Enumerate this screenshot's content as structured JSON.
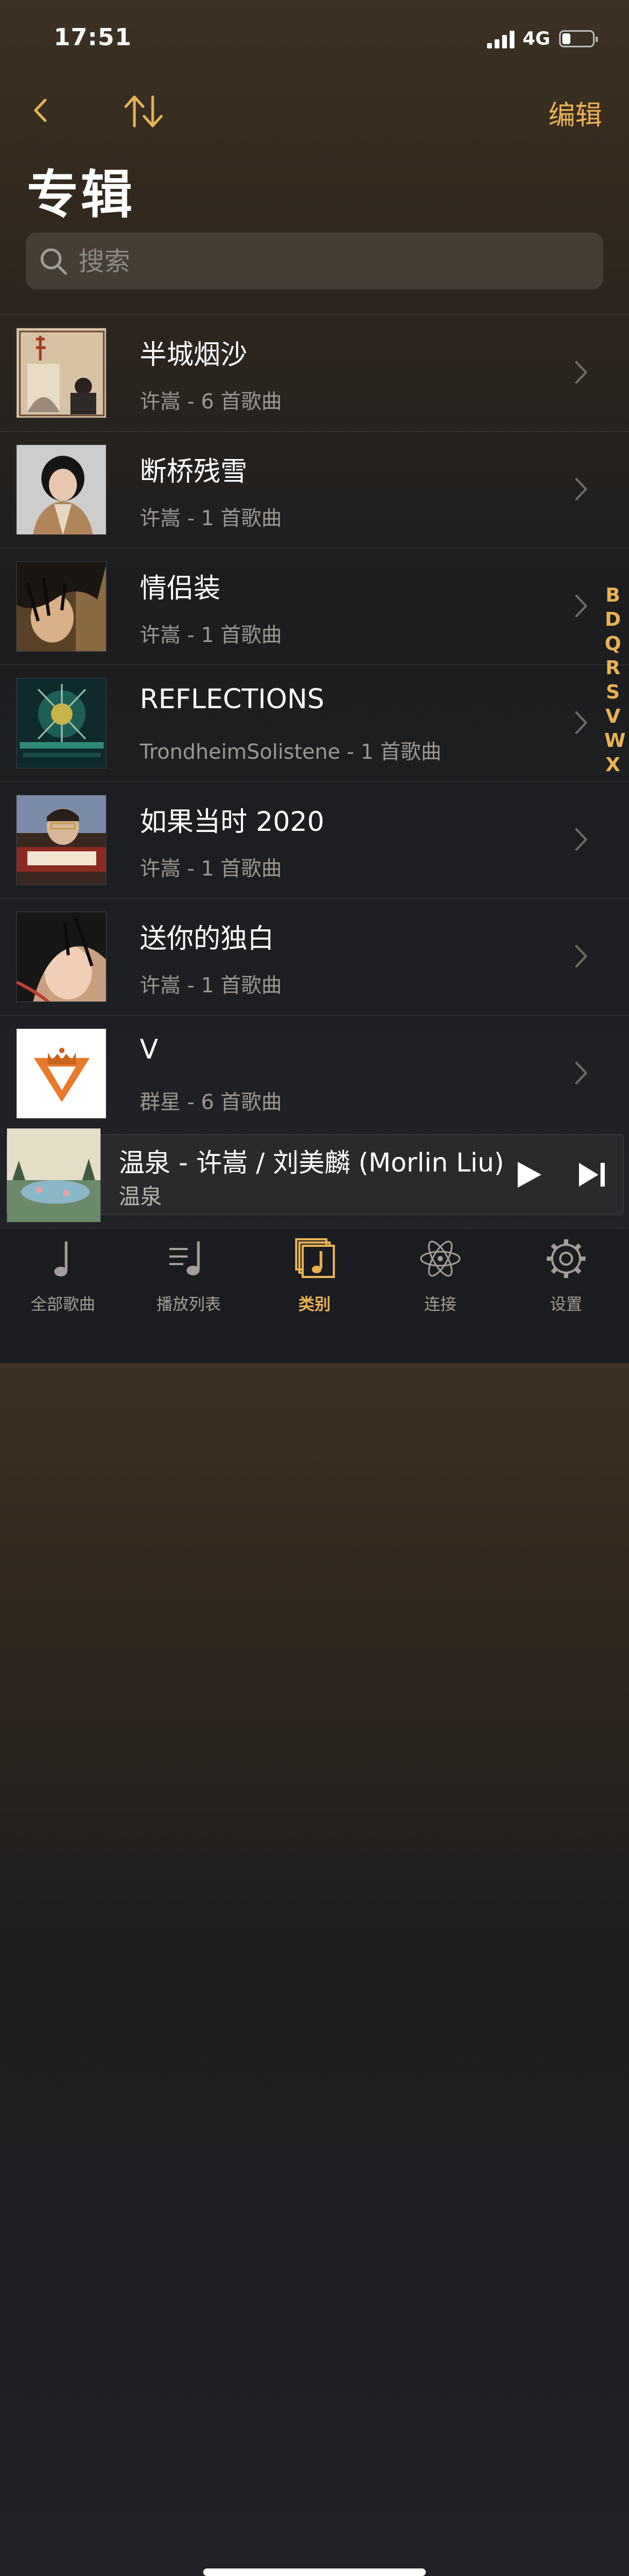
{
  "status_bar": {
    "time": "17:51",
    "network": "4G",
    "battery_level": 0.28
  },
  "nav": {
    "edit_label": "编辑",
    "back_icon": "chevron-left-icon",
    "sort_icon": "sort-arrows-icon"
  },
  "page_title": "专辑",
  "search": {
    "placeholder": "搜索",
    "value": ""
  },
  "albums": [
    {
      "title": "半城烟沙",
      "subtitle": "许嵩 - 6 首歌曲"
    },
    {
      "title": "断桥残雪",
      "subtitle": "许嵩 - 1 首歌曲"
    },
    {
      "title": "情侣装",
      "subtitle": "许嵩 - 1 首歌曲"
    },
    {
      "title": "REFLECTIONS",
      "subtitle": "TrondheimSolistene - 1 首歌曲"
    },
    {
      "title": "如果当时 2020",
      "subtitle": "许嵩 - 1 首歌曲"
    },
    {
      "title": "送你的独白",
      "subtitle": "许嵩 - 1 首歌曲"
    },
    {
      "title": "V",
      "subtitle": "群星 - 6 首歌曲"
    }
  ],
  "index_letters": [
    "B",
    "D",
    "Q",
    "R",
    "S",
    "V",
    "W",
    "X"
  ],
  "mini_player": {
    "title": "温泉 - 许嵩 / 刘美麟 (Morlin Liu)",
    "album": "温泉"
  },
  "tabs": [
    {
      "label": "全部歌曲",
      "icon": "music-note-icon",
      "active": false
    },
    {
      "label": "播放列表",
      "icon": "playlist-icon",
      "active": false
    },
    {
      "label": "类别",
      "icon": "category-icon",
      "active": true
    },
    {
      "label": "连接",
      "icon": "atom-icon",
      "active": false
    },
    {
      "label": "设置",
      "icon": "gear-icon",
      "active": false
    }
  ],
  "colors": {
    "accent": "#e9b255",
    "secondary_text": "#9b9793",
    "background_top": "#3d3224",
    "background_bottom": "#23252a"
  }
}
